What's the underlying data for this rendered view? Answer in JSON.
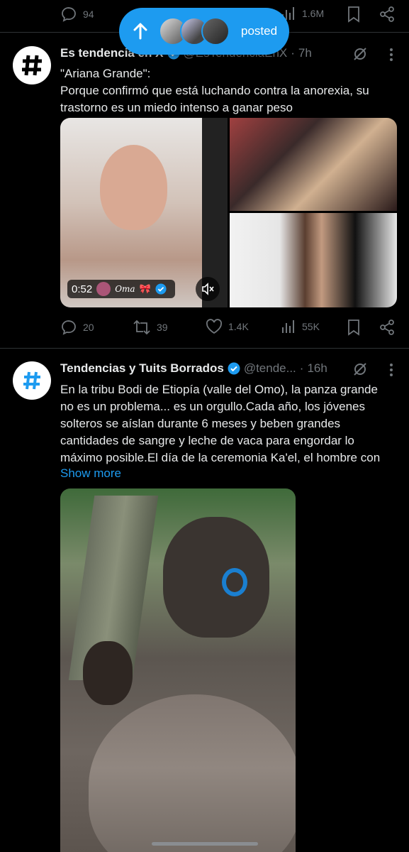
{
  "top_actions": {
    "replies": "94",
    "views": "1.6M"
  },
  "new_posts_pill": {
    "label": "posted"
  },
  "tweets": [
    {
      "name": "Es tendencia en X",
      "handle": "@EsTendenciaEnX",
      "time": "7h",
      "text_lines": [
        "\"Ariana Grande\":",
        "Porque confirmó que está luchando contra la anorexia, su",
        "trastorno es un miedo intenso a ganar peso"
      ],
      "video": {
        "duration": "0:52",
        "overlay_name": "Oma",
        "overlay_emoji": "🎀"
      },
      "actions": {
        "replies": "20",
        "reposts": "39",
        "likes": "1.4K",
        "views": "55K"
      }
    },
    {
      "name": "Tendencias y Tuits Borrados",
      "handle": "@tende...",
      "time": "16h",
      "text_lines": [
        "En la tribu Bodi de Etiopía (valle del Omo), la panza grande",
        "no es un problema... es un orgullo.Cada año, los jóvenes",
        "solteros se aíslan durante 6 meses y beben grandes",
        "cantidades de sangre y leche de vaca para engordar lo",
        "máximo posible.El día de la ceremonia Ka'el, el hombre con"
      ],
      "show_more": "Show more"
    }
  ],
  "colors": {
    "accent": "#1d9bf0",
    "muted": "#71767b",
    "text": "#e7e9ea",
    "divider": "#2f3336"
  }
}
